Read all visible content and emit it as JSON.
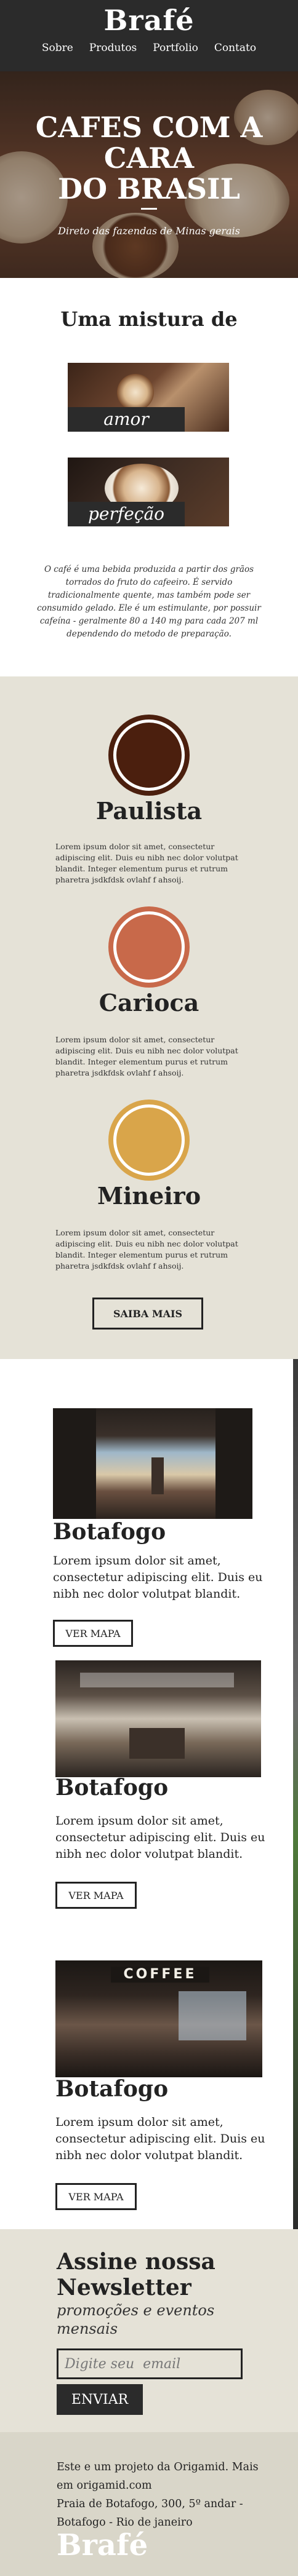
{
  "header": {
    "logo": "Brafé",
    "nav": [
      "Sobre",
      "Produtos",
      "Portfolio",
      "Contato"
    ]
  },
  "hero": {
    "title_lines": [
      "CAFES COM A",
      "CARA",
      "DO BRASIL"
    ],
    "subtitle": "Direto das fazendas de Minas gerais"
  },
  "mixture": {
    "title": "Uma mistura de",
    "items": [
      "amor",
      "perfeção"
    ],
    "text": "O café é uma bebida produzida a partir dos grãos torrados do fruto do cafeeiro. É servido tradicionalmente quente, mas também pode ser consumido gelado. Ele é um estimulante, por possuir cafeína - geralmente 80 a 140 mg para cada 207 ml dependendo do metodo de preparação."
  },
  "varieties": {
    "items": [
      {
        "name": "Paulista",
        "color": "#4b1f0e",
        "text": "Lorem ipsum dolor sit amet, consectetur adipiscing elit. Duis eu nibh nec dolor volutpat blandit. Integer elementum purus et rutrum pharetra jsdkfdsk ovlahf f ahsoij."
      },
      {
        "name": "Carioca",
        "color": "#c8694a",
        "text": "Lorem ipsum dolor sit amet, consectetur adipiscing elit. Duis eu nibh nec dolor volutpat blandit. Integer elementum purus et rutrum pharetra jsdkfdsk ovlahf f ahsoij."
      },
      {
        "name": "Mineiro",
        "color": "#d9a54a",
        "text": "Lorem ipsum dolor sit amet, consectetur adipiscing elit. Duis eu nibh nec dolor volutpat blandit. Integer elementum purus et rutrum pharetra jsdkfdsk ovlahf f ahsoij."
      }
    ],
    "more_button": "SAIBA MAIS"
  },
  "locations": {
    "items": [
      {
        "name": "Botafogo",
        "text": "Lorem ipsum dolor sit amet, consectetur adipiscing elit. Duis eu nibh nec dolor volutpat blandit.",
        "button": "VER MAPA"
      },
      {
        "name": "Botafogo",
        "text": "Lorem ipsum dolor sit amet, consectetur adipiscing elit. Duis eu nibh nec dolor volutpat blandit.",
        "button": "VER MAPA"
      },
      {
        "name": "Botafogo",
        "text": "Lorem ipsum dolor sit amet, consectetur adipiscing elit. Duis eu nibh nec dolor volutpat blandit.",
        "button": "VER MAPA"
      }
    ],
    "sign_text": "COFFEE"
  },
  "newsletter": {
    "title_lines": [
      "Assine nossa",
      "Newsletter"
    ],
    "subtitle_lines": [
      "promoções e eventos",
      "mensais"
    ],
    "email_placeholder": "Digite seu  email",
    "submit_label": "ENVIAR"
  },
  "footer": {
    "lines": [
      "Este e um projeto da Origamid. Mais em origamid.com",
      "Praia de Botafogo, 300, 5º andar - Botafogo - Rio de janeiro"
    ],
    "logo": "Brafé"
  }
}
